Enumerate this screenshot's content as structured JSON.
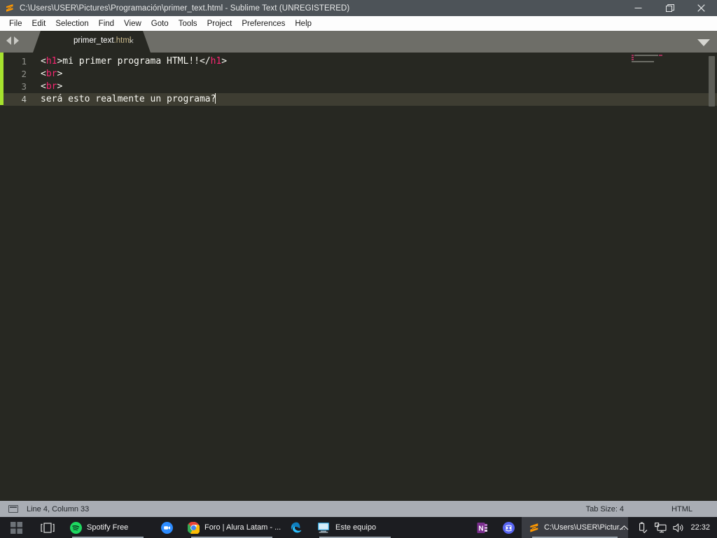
{
  "window": {
    "title": "C:\\Users\\USER\\Pictures\\Programación\\primer_text.html - Sublime Text (UNREGISTERED)",
    "app_icon": "sublime-text-logo",
    "controls": {
      "minimize": "minimize-icon",
      "restore": "restore-icon",
      "close": "close-icon"
    }
  },
  "menubar": {
    "items": [
      {
        "label": "File"
      },
      {
        "label": "Edit"
      },
      {
        "label": "Selection"
      },
      {
        "label": "Find"
      },
      {
        "label": "View"
      },
      {
        "label": "Goto"
      },
      {
        "label": "Tools"
      },
      {
        "label": "Project"
      },
      {
        "label": "Preferences"
      },
      {
        "label": "Help"
      }
    ]
  },
  "tabbar": {
    "nav_back_icon": "chevron-left-icon",
    "nav_forward_icon": "chevron-right-icon",
    "dropdown_icon": "chevron-down-icon",
    "tabs": [
      {
        "name": "primer_text",
        "ext": ".html",
        "close_icon": "close-icon",
        "active": true
      }
    ]
  },
  "editor": {
    "lines": [
      {
        "number": "1",
        "segments": [
          {
            "text": "<",
            "cls": "tagpunct"
          },
          {
            "text": "h1",
            "cls": "tagname"
          },
          {
            "text": ">mi primer programa HTML!!</",
            "cls": "tagpunct"
          },
          {
            "text": "h1",
            "cls": "tagname"
          },
          {
            "text": ">",
            "cls": "tagpunct"
          }
        ]
      },
      {
        "number": "2",
        "segments": [
          {
            "text": "<",
            "cls": "tagpunct"
          },
          {
            "text": "br",
            "cls": "tagname"
          },
          {
            "text": ">",
            "cls": "tagpunct"
          }
        ]
      },
      {
        "number": "3",
        "segments": [
          {
            "text": "<",
            "cls": "tagpunct"
          },
          {
            "text": "br",
            "cls": "tagname"
          },
          {
            "text": ">",
            "cls": "tagpunct"
          }
        ]
      },
      {
        "number": "4",
        "current": true,
        "cursor": true,
        "segments": [
          {
            "text": "será esto realmente un programa?",
            "cls": "tagpunct"
          }
        ]
      }
    ],
    "colors": {
      "background": "#272822",
      "current_line": "#3e3d32",
      "tag_name": "#f92672",
      "foreground": "#f8f8f2",
      "line_number": "#90918b",
      "modified_strip": "#a6e22e"
    }
  },
  "statusbar": {
    "console_icon": "console-icon",
    "cursor_position": "Line 4, Column 33",
    "tab_size": "Tab Size: 4",
    "syntax": "HTML"
  },
  "taskbar": {
    "start_icon": "windows-start-icon",
    "taskview_icon": "task-view-icon",
    "buttons": [
      {
        "label": "Spotify Free",
        "icon": "spotify-icon",
        "running": true,
        "active": false
      },
      {
        "label": "",
        "icon": "zoom-icon",
        "running": false,
        "active": false
      },
      {
        "label": "Foro | Alura Latam - ...",
        "icon": "chrome-icon",
        "running": true,
        "active": false
      },
      {
        "label": "",
        "icon": "edge-icon",
        "running": false,
        "active": false
      },
      {
        "label": "Este equipo",
        "icon": "file-explorer-icon",
        "running": true,
        "active": false
      },
      {
        "label": "",
        "icon": "onenote-icon",
        "running": false,
        "active": false
      },
      {
        "label": "",
        "icon": "discord-icon",
        "running": false,
        "active": false
      },
      {
        "label": "C:\\Users\\USER\\Pictur...",
        "icon": "sublime-text-icon",
        "running": true,
        "active": true
      }
    ],
    "tray": {
      "overflow_icon": "chevron-up-icon",
      "usb_icon": "usb-safely-remove-icon",
      "network_icon": "network-monitor-icon",
      "volume_icon": "volume-icon",
      "clock": "22:32"
    }
  }
}
